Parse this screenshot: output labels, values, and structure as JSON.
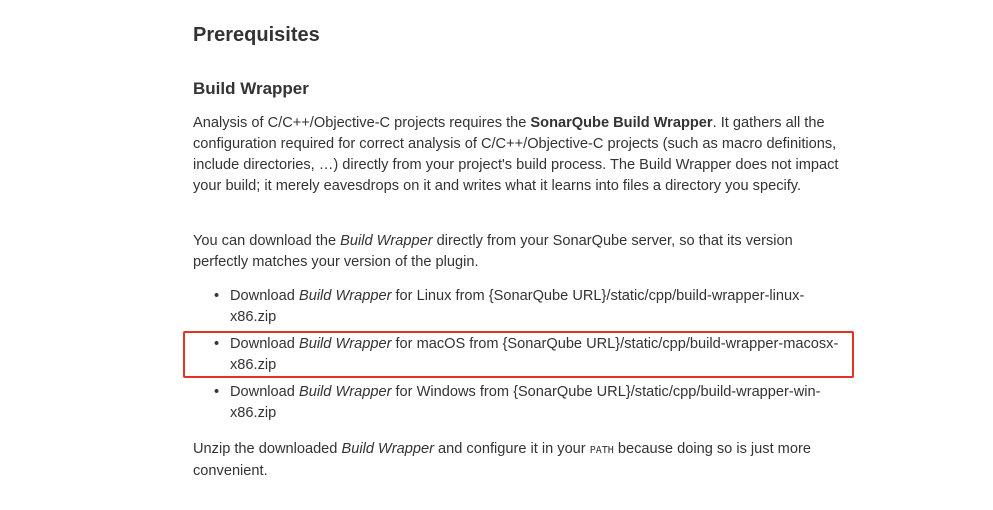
{
  "page": {
    "heading": "Prerequisites",
    "subheading": "Build Wrapper"
  },
  "intro": {
    "before": "Analysis of C/C++/Objective-C projects requires the ",
    "strong": "SonarQube Build Wrapper",
    "after": ". It gathers all the configuration required for correct analysis of C/C++/Objective-C projects (such as macro definitions, include directories, …) directly from your project's build process. The Build Wrapper does not impact your build; it merely eavesdrops on it and writes what it learns into files a directory you specify."
  },
  "download_intro": {
    "before": "You can download the ",
    "em": "Build Wrapper",
    "after": " directly from your SonarQube server, so that its version perfectly matches your version of the plugin."
  },
  "downloads": [
    {
      "bullet": "•",
      "prefix": "Download ",
      "em": "Build Wrapper",
      "suffix": " for Linux from {SonarQube URL}/static/cpp/build-wrapper-linux-x86.zip"
    },
    {
      "bullet": "•",
      "prefix": "Download ",
      "em": "Build Wrapper",
      "suffix": " for macOS from {SonarQube URL}/static/cpp/build-wrapper-macosx-x86.zip"
    },
    {
      "bullet": "•",
      "prefix": "Download ",
      "em": "Build Wrapper",
      "suffix": " for Windows from {SonarQube URL}/static/cpp/build-wrapper-win-x86.zip"
    }
  ],
  "outro": {
    "before": "Unzip the downloaded ",
    "em": "Build Wrapper",
    "middle": " and configure it in your ",
    "code": "PATH",
    "after": " because doing so is just more convenient."
  },
  "colors": {
    "text": "#333333",
    "highlight_border": "#e0341f",
    "background": "#ffffff"
  }
}
